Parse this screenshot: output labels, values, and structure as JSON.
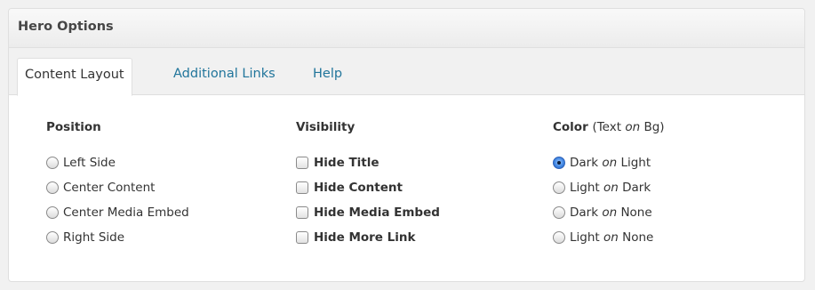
{
  "panel": {
    "title": "Hero Options"
  },
  "tabs": [
    {
      "label": "Content Layout",
      "active": true
    },
    {
      "label": "Additional Links",
      "active": false
    },
    {
      "label": "Help",
      "active": false
    }
  ],
  "position": {
    "title": "Position",
    "options": [
      {
        "label": "Left Side",
        "checked": false
      },
      {
        "label": "Center Content",
        "checked": false
      },
      {
        "label": "Center Media Embed",
        "checked": false
      },
      {
        "label": "Right Side",
        "checked": false
      }
    ]
  },
  "visibility": {
    "title": "Visibility",
    "options": [
      {
        "label": "Hide Title",
        "checked": false
      },
      {
        "label": "Hide Content",
        "checked": false
      },
      {
        "label": "Hide Media Embed",
        "checked": false
      },
      {
        "label": "Hide More Link",
        "checked": false
      }
    ]
  },
  "color": {
    "title": "Color",
    "subtitle_pre": "(Text ",
    "subtitle_on": "on",
    "subtitle_post": " Bg)",
    "options": [
      {
        "a": "Dark ",
        "on": "on",
        "b": " Light",
        "checked": true
      },
      {
        "a": "Light ",
        "on": "on",
        "b": " Dark",
        "checked": false
      },
      {
        "a": "Dark ",
        "on": "on",
        "b": " None",
        "checked": false
      },
      {
        "a": "Light ",
        "on": "on",
        "b": " None",
        "checked": false
      }
    ]
  },
  "colors": {
    "link": "#21759b",
    "radio_selected": "#3b82e0"
  }
}
